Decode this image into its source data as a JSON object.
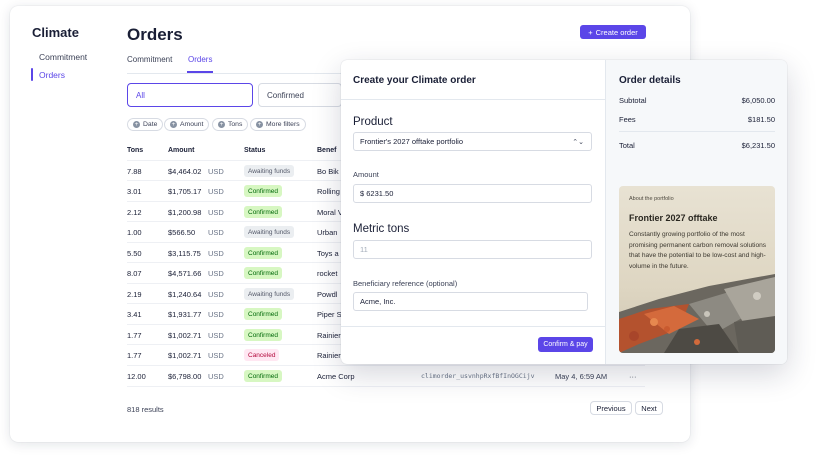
{
  "sidebar": {
    "title": "Climate",
    "items": [
      {
        "label": "Commitment",
        "active": false
      },
      {
        "label": "Orders",
        "active": true
      }
    ]
  },
  "header": {
    "title": "Orders",
    "create_button": "Create order"
  },
  "tabs": [
    {
      "label": "Commitment",
      "active": false
    },
    {
      "label": "Orders",
      "active": true
    }
  ],
  "segments": {
    "all": "All",
    "confirmed": "Confirmed"
  },
  "filters": [
    "Date",
    "Amount",
    "Tons",
    "More filters"
  ],
  "table": {
    "headers": {
      "tons": "Tons",
      "amount": "Amount",
      "status": "Status",
      "beneficiary": "Benef"
    },
    "rows": [
      {
        "tons": "7.88",
        "amount": "$4,464.02",
        "currency": "USD",
        "status": "Awaiting funds",
        "beneficiary": "Bo Bik"
      },
      {
        "tons": "3.01",
        "amount": "$1,705.17",
        "currency": "USD",
        "status": "Confirmed",
        "beneficiary": "Rolling"
      },
      {
        "tons": "2.12",
        "amount": "$1,200.98",
        "currency": "USD",
        "status": "Confirmed",
        "beneficiary": "Moral V"
      },
      {
        "tons": "1.00",
        "amount": "$566.50",
        "currency": "USD",
        "status": "Awaiting funds",
        "beneficiary": "Urban"
      },
      {
        "tons": "5.50",
        "amount": "$3,115.75",
        "currency": "USD",
        "status": "Confirmed",
        "beneficiary": "Toys a"
      },
      {
        "tons": "8.07",
        "amount": "$4,571.66",
        "currency": "USD",
        "status": "Confirmed",
        "beneficiary": "rocket"
      },
      {
        "tons": "2.19",
        "amount": "$1,240.64",
        "currency": "USD",
        "status": "Awaiting funds",
        "beneficiary": "Powdl"
      },
      {
        "tons": "3.41",
        "amount": "$1,931.77",
        "currency": "USD",
        "status": "Confirmed",
        "beneficiary": "Piper S"
      },
      {
        "tons": "1.77",
        "amount": "$1,002.71",
        "currency": "USD",
        "status": "Confirmed",
        "beneficiary": "Rainier"
      },
      {
        "tons": "1.77",
        "amount": "$1,002.71",
        "currency": "USD",
        "status": "Canceled",
        "beneficiary": "Rainier"
      },
      {
        "tons": "12.00",
        "amount": "$6,798.00",
        "currency": "USD",
        "status": "Confirmed",
        "beneficiary": "Acme Corp",
        "id": "climorder_usvnhpRxfBfInOGCijv",
        "date": "May 4, 6:59 AM",
        "more": "···"
      }
    ]
  },
  "pagination": {
    "results": "818 results",
    "previous": "Previous",
    "next": "Next"
  },
  "modal": {
    "title": "Create your Climate order",
    "product_label": "Product",
    "product_value": "Frontier's 2027 offtake portfolio",
    "amount_label": "Amount",
    "amount_value": "$  6231.50",
    "tons_label": "Metric tons",
    "tons_placeholder": "11",
    "beneficiary_label": "Beneficiary reference (optional)",
    "beneficiary_value": "Acme, Inc.",
    "confirm_button": "Confirm & pay"
  },
  "order_details": {
    "title": "Order details",
    "subtotal_label": "Subtotal",
    "subtotal_value": "$6,050.00",
    "fees_label": "Fees",
    "fees_value": "$181.50",
    "total_label": "Total",
    "total_value": "$6,231.50"
  },
  "portfolio": {
    "kicker": "About the portfolio",
    "title": "Frontier 2027 offtake",
    "description": "Constantly growing portfolio of the most promising permanent carbon removal solutions that have the potential to be low-cost and high-volume in the future."
  },
  "colors": {
    "accent": "#5b46e8",
    "confirmed_bg": "#d7f7c2",
    "confirmed_text": "#006908"
  }
}
